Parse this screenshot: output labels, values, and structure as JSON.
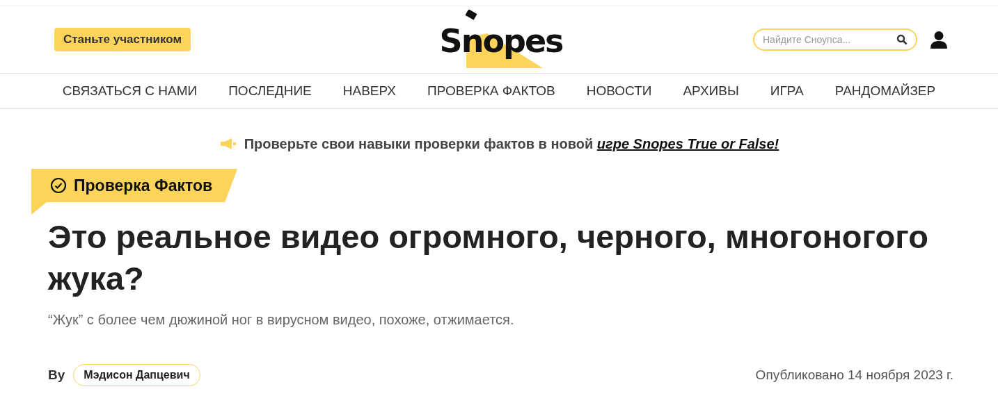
{
  "header": {
    "join_button": "Станьте участником",
    "logo": "Snopes",
    "search": {
      "placeholder": "Найдите Сноупса..."
    }
  },
  "nav": [
    "СВЯЗАТЬСЯ С НАМИ",
    "ПОСЛЕДНИЕ",
    "НАВЕРХ",
    "ПРОВЕРКА ФАКТОВ",
    "НОВОСТИ",
    "АРХИВЫ",
    "ИГРА",
    "РАНДОМАЙЗЕР"
  ],
  "promo": {
    "text": "Проверьте свои навыки проверки фактов в новой",
    "link": "игре Snopes True or False!"
  },
  "article": {
    "tag": "Проверка Фактов",
    "title": "Это реальное видео огромного, черного, многоногого жука?",
    "subtitle": "“Жук” с более чем дюжиной ног в вирусном видео, похоже, отжимается.",
    "by": "By",
    "author": "Мэдисон Дапцевич",
    "published": "Опубликовано 14 ноября 2023 г."
  }
}
